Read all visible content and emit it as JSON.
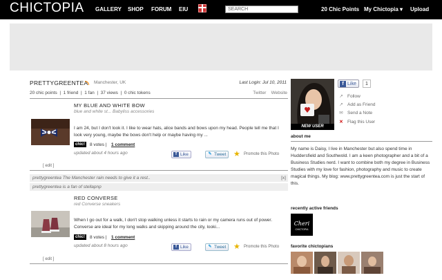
{
  "header": {
    "logo": "CHICTOPIA",
    "nav": [
      "GALLERY",
      "SHOP",
      "FORUM",
      "EIU"
    ],
    "search_placeholder": "SEARCH",
    "right_nav": [
      "20 Chic Points",
      "My Chictopia ▾",
      "Upload"
    ]
  },
  "profile": {
    "username": "PRETTYGREENTEA",
    "location": "Manchester, UK",
    "last_login": "Last Login: Jul 10, 2011",
    "stats": "20 chic points  |  1 friend  |  1 fan  |  37 views  |  0 chic tokens",
    "links": [
      "Twitter",
      "Website"
    ]
  },
  "posts": [
    {
      "title": "MY BLUE AND WHITE BOW",
      "subtitle": "blue and white st... Babyliss accessories",
      "body": "I am 24, but I don't look it. I like to wear hats, alice bands and bows upon my head. People tell me that I look very young, maybe the bows don't help or maybe having my ...",
      "chic": "chic!",
      "votes": "8 votes |",
      "comment": "1 comment",
      "updated": "updated about 4 hours ago",
      "edit": "[ edit ]"
    },
    {
      "title": "RED CONVERSE",
      "subtitle": "red Converse sneakers",
      "body": "When I go out for a walk, I don't stop walking unless it starts to rain or my camera runs out of power. Converse are ideal for my long walks and skipping around the city, looki...",
      "chic": "chic!",
      "votes": "8 votes |",
      "comment": "1 comment",
      "updated": "updated about 8 hours ago",
      "edit": "[ edit ]"
    }
  ],
  "share": {
    "like": "Like",
    "tweet": "Tweet",
    "promote": "Promote this Photo"
  },
  "activity": [
    {
      "text": "prettygreentea The Manchester rain needs to give it a rest..",
      "close": "[x]"
    },
    {
      "text": "prettygreentea is a fan of stellapnp"
    }
  ],
  "sidebar": {
    "new_user": "NEW USER",
    "like_label": "Like",
    "like_count": "1",
    "actions": [
      {
        "icon": "follow-icon",
        "label": "Follow"
      },
      {
        "icon": "add-friend-icon",
        "label": "Add as Friend"
      },
      {
        "icon": "mail-icon",
        "label": "Send a Note"
      },
      {
        "icon": "flag-icon",
        "label": "Flag this User"
      }
    ],
    "about_heading": "about me",
    "about_text": "My name is Daisy, I live in Manchester but also spend time in Huddersfield and Southwold. I am a keen photographer and a bit of a Business Studies nerd. I want to combine both my degree in Business Studies with my love for fashion, photography and music to create magical things. My blog: www.prettygreentea.com is just the start of this.",
    "friends_heading": "recently active friends",
    "friend_logo": [
      "Cheri",
      "CHICTOPIA"
    ],
    "favorites_heading": "favorite chictopians"
  },
  "colors": {
    "topbar": "#000000",
    "facebook": "#3b5998",
    "ad_bg": "#e9e9e9"
  }
}
